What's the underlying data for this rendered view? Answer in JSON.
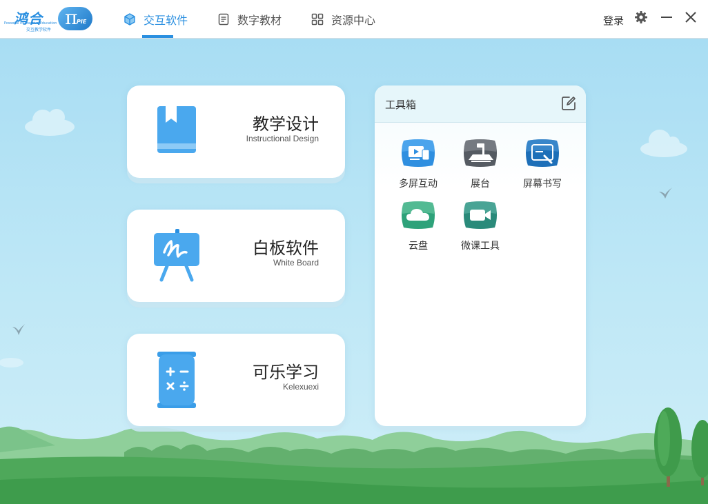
{
  "logo": {
    "text_cn": "鸿合",
    "text_en": "Powerful Interactive Education",
    "text_sub": "交互教学软件",
    "pi": "π",
    "pie": "PIE"
  },
  "tabs": [
    {
      "label": "交互软件",
      "active": true,
      "icon": "cube-icon"
    },
    {
      "label": "数字教材",
      "active": false,
      "icon": "document-icon"
    },
    {
      "label": "资源中心",
      "active": false,
      "icon": "grid-icon"
    }
  ],
  "header": {
    "login_label": "登录",
    "settings_icon": "gear-icon",
    "minimize_icon": "minimize-icon",
    "close_icon": "close-icon"
  },
  "cards": [
    {
      "title": "教学设计",
      "subtitle": "Instructional Design",
      "icon": "book-icon"
    },
    {
      "title": "白板软件",
      "subtitle": "White Board",
      "icon": "easel-icon"
    },
    {
      "title": "可乐学习",
      "subtitle": "Kelexuexi",
      "icon": "calculator-can-icon"
    }
  ],
  "toolbox": {
    "title": "工具箱",
    "edit_icon": "edit-icon",
    "tools": [
      {
        "label": "多屏互动",
        "icon": "multi-screen-icon"
      },
      {
        "label": "展台",
        "icon": "document-camera-icon"
      },
      {
        "label": "屏幕书写",
        "icon": "screen-write-icon"
      },
      {
        "label": "云盘",
        "icon": "cloud-icon"
      },
      {
        "label": "微课工具",
        "icon": "video-camera-icon"
      }
    ]
  },
  "colors": {
    "accent": "#2a8fe0",
    "sky": "#b4e3f5",
    "grass": "#3e9c4c"
  }
}
